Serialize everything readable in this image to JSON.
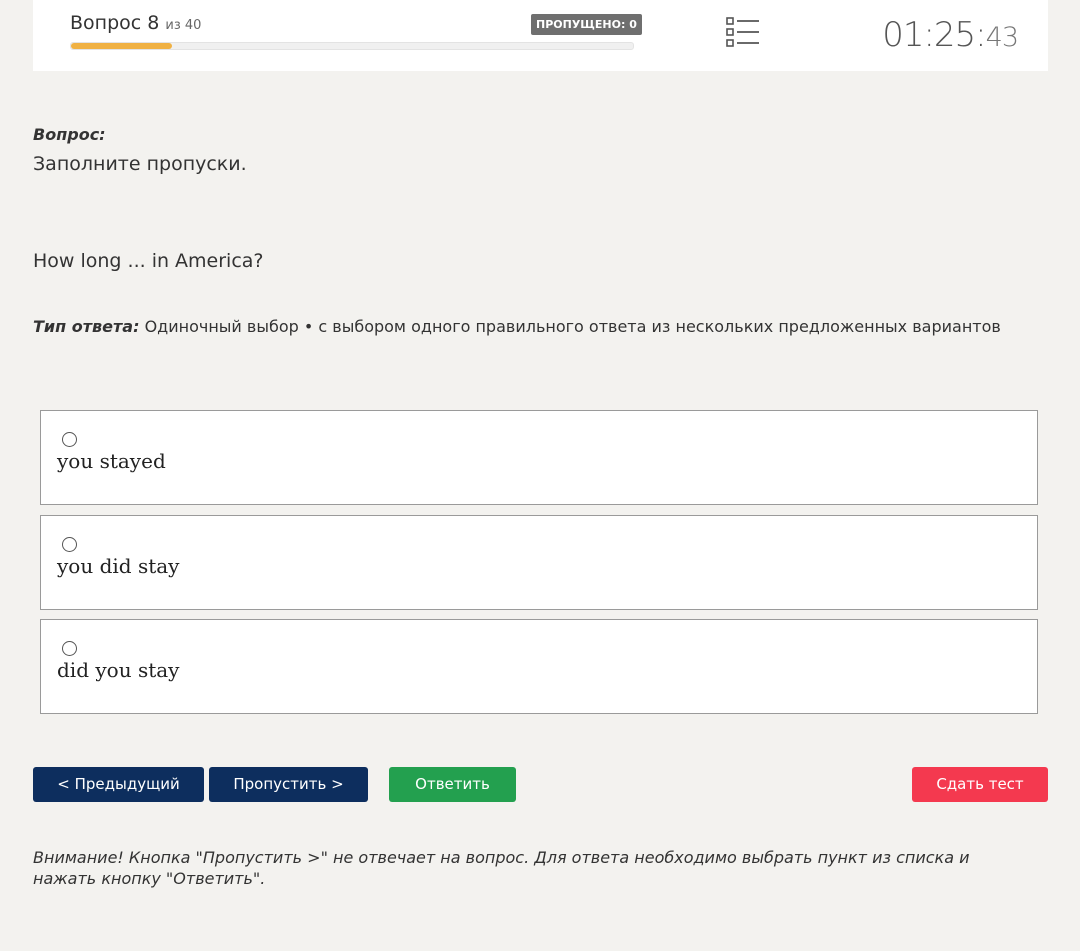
{
  "header": {
    "question_prefix": "Вопрос 8",
    "question_of": "из 40",
    "skipped_label": "ПРОПУЩЕНО: 0",
    "progress_fraction": 0.18,
    "progress_color": "#f0b143",
    "list_icon": "list-icon",
    "timer_main": "01:25:",
    "timer_seconds": "43"
  },
  "question": {
    "caption": "Вопрос:",
    "instruction": "Заполните пропуски.",
    "text": "How long ... in America?",
    "answer_type_label": "Тип ответа:",
    "answer_type_value": "Одиночный выбор • с выбором одного правильного ответа из нескольких предложенных вариантов"
  },
  "options": [
    {
      "label": "you stayed"
    },
    {
      "label": "you did stay"
    },
    {
      "label": "did you stay"
    }
  ],
  "buttons": {
    "prev": "< Предыдущий",
    "skip": "Пропустить >",
    "answer": "Ответить",
    "submit": "Сдать тест"
  },
  "colors": {
    "nav_button": "#0d2e5e",
    "answer_button": "#23a04f",
    "submit_button": "#f4394f"
  },
  "warning": "Внимание! Кнопка \"Пропустить >\" не отвечает на вопрос. Для ответа необходимо выбрать пункт из списка и нажать кнопку \"Ответить\"."
}
